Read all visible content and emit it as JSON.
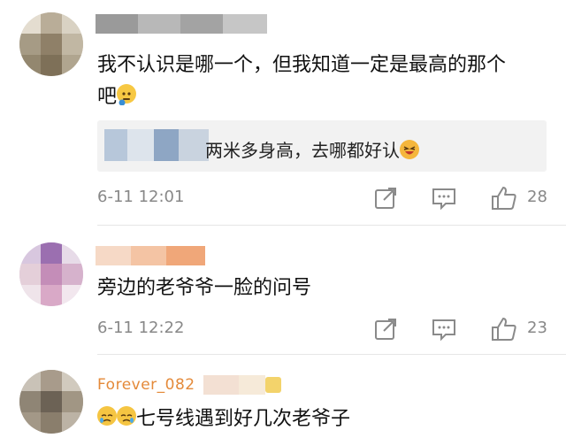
{
  "comments": [
    {
      "text_line1": "我不认识是哪一个，但我知道一定是最高的那个",
      "text_line2": "吧",
      "emoji_icon": "thinking-face-icon",
      "reply": {
        "text": "两米多身高，去哪都好认",
        "emoji_icon": "laughing-face-icon"
      },
      "time": "6-11 12:01",
      "likes": "28"
    },
    {
      "text": "旁边的老爷爷一脸的问号",
      "time": "6-11 12:22",
      "likes": "23"
    },
    {
      "username_partial": "Forever_082",
      "text": "七号线遇到好几次老爷子",
      "emoji_icons": [
        "crying-face-icon",
        "crying-face-icon"
      ]
    }
  ],
  "icons": {
    "share": "share-icon",
    "reply": "comment-icon",
    "like": "thumbs-up-icon"
  },
  "colors": {
    "meta_text": "#888888",
    "reply_bg": "#f2f2f2"
  }
}
